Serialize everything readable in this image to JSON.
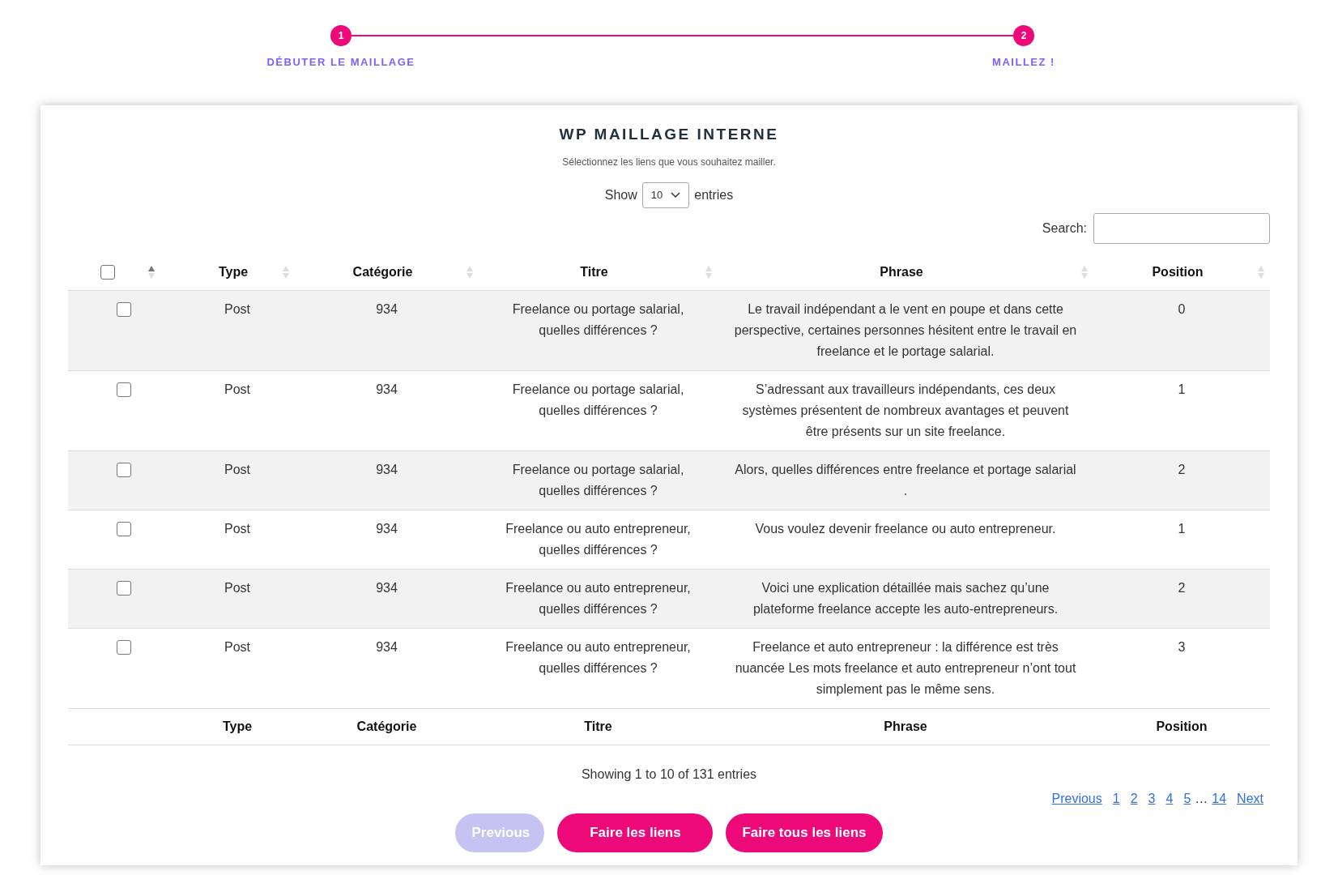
{
  "stepper": [
    {
      "number": "1",
      "label": "DÉBUTER LE MAILLAGE"
    },
    {
      "number": "2",
      "label": "MAILLEZ !"
    }
  ],
  "title": "WP MAILLAGE INTERNE",
  "subtitle": "Sélectionnez les liens que vous souhaitez mailler.",
  "length_menu": {
    "before": "Show",
    "value": "10",
    "after": "entries"
  },
  "search": {
    "label": "Search:"
  },
  "select_all": {
    "checked": false,
    "sorted": true
  },
  "columns": [
    {
      "label": "Type",
      "sorted": false
    },
    {
      "label": "Catégorie",
      "sorted": false
    },
    {
      "label": "Titre",
      "sorted": false
    },
    {
      "label": "Phrase",
      "sorted": false
    },
    {
      "label": "Position",
      "sorted": false
    }
  ],
  "rows": [
    {
      "checked": false,
      "cells": [
        "Post",
        "934",
        "Freelance ou portage salarial, quelles différences ?",
        "Le travail indépendant a le vent en poupe et dans cette perspective, certaines personnes hésitent entre le travail en freelance et le portage salarial.",
        "0"
      ]
    },
    {
      "checked": false,
      "cells": [
        "Post",
        "934",
        "Freelance ou portage salarial, quelles différences ?",
        "S’adressant aux travailleurs indépendants, ces deux systèmes présentent de nombreux avantages et peuvent être présents sur un site freelance.",
        "1"
      ]
    },
    {
      "checked": false,
      "cells": [
        "Post",
        "934",
        "Freelance ou portage salarial, quelles différences ?",
        "Alors, quelles différences entre freelance et portage salarial .",
        "2"
      ]
    },
    {
      "checked": false,
      "cells": [
        "Post",
        "934",
        "Freelance ou auto entrepreneur, quelles différences ?",
        "Vous voulez devenir freelance ou auto entrepreneur.",
        "1"
      ]
    },
    {
      "checked": false,
      "cells": [
        "Post",
        "934",
        "Freelance ou auto entrepreneur, quelles différences ?",
        "Voici une explication détaillée mais sachez qu’une plateforme freelance accepte les auto-entrepreneurs.",
        "2"
      ]
    },
    {
      "checked": false,
      "cells": [
        "Post",
        "934",
        "Freelance ou auto entrepreneur, quelles différences ?",
        "Freelance et auto entrepreneur : la différence est très nuancée Les mots freelance et auto entrepreneur n’ont tout simplement pas le même sens.",
        "3"
      ]
    }
  ],
  "footer_columns": [
    "Type",
    "Catégorie",
    "Titre",
    "Phrase",
    "Position"
  ],
  "info": "Showing 1 to 10 of 131 entries",
  "pagination": [
    "Previous",
    "1",
    "2",
    "3",
    "4",
    "5",
    "…",
    "14",
    "Next"
  ],
  "buttons": [
    {
      "label": "Previous",
      "disabled": true
    },
    {
      "label": "Faire les liens",
      "disabled": false
    },
    {
      "label": "Faire tous les liens",
      "disabled": false
    }
  ]
}
